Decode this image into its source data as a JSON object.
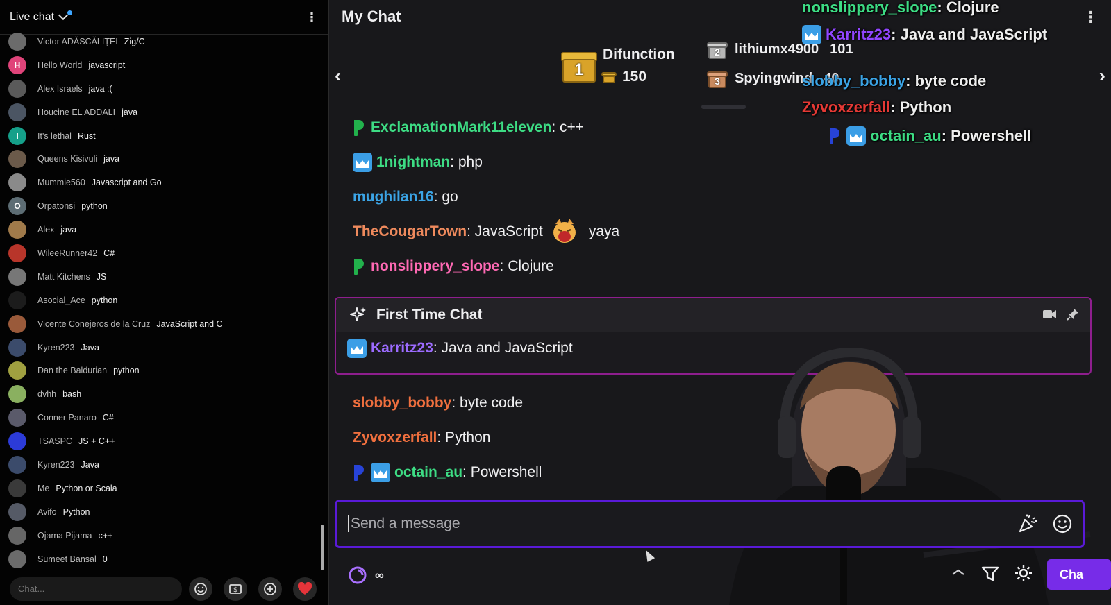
{
  "yt": {
    "title": "Live chat",
    "input_placeholder": "Chat...",
    "messages": [
      {
        "name": "Victor ADĂSCĂLIȚEI",
        "text": "Zig/C",
        "avatar": "",
        "color": "#6b6b6b"
      },
      {
        "name": "Hello World",
        "text": "javascript",
        "avatar": "H",
        "color": "#e0447a"
      },
      {
        "name": "Alex Israels",
        "text": "java :(",
        "avatar": "",
        "color": "#5a5a5a"
      },
      {
        "name": "Houcine EL ADDALI",
        "text": "java",
        "avatar": "",
        "color": "#4b5563"
      },
      {
        "name": "It's lethal",
        "text": "Rust",
        "avatar": "I",
        "color": "#15a08a"
      },
      {
        "name": "Queens Kisivuli",
        "text": "java",
        "avatar": "",
        "color": "#6b5a4a"
      },
      {
        "name": "Mummie560",
        "text": "Javascript and Go",
        "avatar": "",
        "color": "#8a8a8a"
      },
      {
        "name": "Orpatonsi",
        "text": "python",
        "avatar": "O",
        "color": "#5d6d74"
      },
      {
        "name": "Alex",
        "text": "java",
        "avatar": "",
        "color": "#a07a4a"
      },
      {
        "name": "WileeRunner42",
        "text": "C#",
        "avatar": "",
        "color": "#b8352a"
      },
      {
        "name": "Matt Kitchens",
        "text": "JS",
        "avatar": "",
        "color": "#777777"
      },
      {
        "name": "Asocial_Ace",
        "text": "python",
        "avatar": "",
        "color": "#1c1c1c"
      },
      {
        "name": "Vicente Conejeros de la Cruz",
        "text": "JavaScript and C",
        "avatar": "",
        "color": "#9a5a3a"
      },
      {
        "name": "Kyren223",
        "text": "Java",
        "avatar": "",
        "color": "#3b4b6b"
      },
      {
        "name": "Dan the Baldurian",
        "text": "python",
        "avatar": "",
        "color": "#a0a040"
      },
      {
        "name": "dvhh",
        "text": "bash",
        "avatar": "",
        "color": "#8ab060"
      },
      {
        "name": "Conner Panaro",
        "text": "C#",
        "avatar": "",
        "color": "#5a5a6a"
      },
      {
        "name": "TSASPC",
        "text": "JS + C++",
        "avatar": "",
        "color": "#2c3bd8"
      },
      {
        "name": "Kyren223",
        "text": "Java",
        "avatar": "",
        "color": "#3b4b6b"
      },
      {
        "name": "Me",
        "text": "Python or Scala",
        "avatar": "",
        "color": "#3a3a3a"
      },
      {
        "name": "Avifo",
        "text": "Python",
        "avatar": "",
        "color": "#555a66"
      },
      {
        "name": "Ojama Pijama",
        "text": "c++",
        "avatar": "",
        "color": "#666666"
      },
      {
        "name": "Sumeet Bansal",
        "text": "0",
        "avatar": "",
        "color": "#6b6b6b"
      }
    ]
  },
  "tw": {
    "title": "My Chat",
    "leaderboard": {
      "first": {
        "rank": "1",
        "name": "Difunction",
        "count": "150"
      },
      "second": {
        "rank": "2",
        "name": "lithiumx4900",
        "count": "101"
      },
      "third": {
        "rank": "3",
        "name": "Spyingwind",
        "count": "40"
      }
    },
    "messages": [
      {
        "user": "ExclamationMark11eleven",
        "text": ": c++",
        "color": "#3ddc84",
        "badge": "p",
        "badgeColor": "#22b14c"
      },
      {
        "user": "1nightman",
        "text": ": php",
        "color": "#3ddc84",
        "badge": "crown"
      },
      {
        "user": "mughilan16",
        "text": ": go",
        "color": "#3ba4e6"
      },
      {
        "user": "TheCougarTown",
        "text": ": JavaScript",
        "after": "yaya",
        "color": "#ef8a5d",
        "emote": true
      },
      {
        "user": "nonslippery_slope",
        "text": ": Clojure",
        "color": "#ff69b4",
        "badge": "p",
        "badgeColor": "#22b14c"
      },
      {
        "user": "slobby_bobby",
        "text": ": byte code",
        "color": "#ef6f3e"
      },
      {
        "user": "Zyvoxzerfall",
        "text": ": Python",
        "color": "#ef6f3e"
      },
      {
        "user": "octain_au",
        "text": ": Powershell",
        "color": "#3ddc84",
        "badge": "p",
        "badgeColor": "#2743d8",
        "badge2": "crown"
      }
    ],
    "first_time": {
      "title": "First Time Chat",
      "user": "Karritz23",
      "text": ": Java and JavaScript",
      "color": "#9c6bff"
    },
    "overlay": [
      {
        "user": "nonslippery_slope",
        "text": ": Clojure",
        "color": "#3ddc84"
      },
      {
        "user": "Karritz23",
        "text": ": Java and JavaScript",
        "color": "#9146ff"
      },
      {
        "user": "slobby_bobby",
        "text": ": byte code",
        "color": "#3ba4e6"
      },
      {
        "user": "Zyvoxzerfall",
        "text": ": Python",
        "color": "#e53935"
      },
      {
        "user": "octain_au",
        "text": ": Powershell",
        "color": "#3ddc84"
      }
    ],
    "input_placeholder": "Send a message",
    "points": "∞",
    "chat_button": "Cha"
  }
}
